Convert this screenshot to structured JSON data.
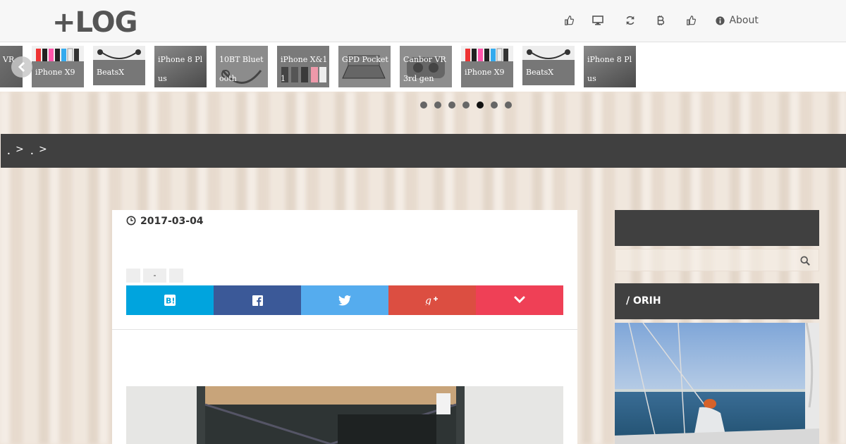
{
  "header": {
    "logo": "+LOG",
    "nav": [
      {
        "icon": "thumbs-up-icon"
      },
      {
        "icon": "desktop-icon"
      },
      {
        "icon": "refresh-icon"
      },
      {
        "icon": "bitcoin-icon"
      },
      {
        "icon": "thumbs-up-icon"
      },
      {
        "icon": "info-icon",
        "label": "About"
      }
    ]
  },
  "slider": {
    "items": [
      {
        "label": "VR"
      },
      {
        "label": "iPhone X9"
      },
      {
        "label": "BeatsX"
      },
      {
        "label": "iPhone 8 Plus"
      },
      {
        "label": "10BT Bluetooth"
      },
      {
        "label": "iPhone X&11"
      },
      {
        "label": "GPD Pocket"
      },
      {
        "label": "Canbor VR 3rd gen"
      },
      {
        "label": "iPhone X9"
      },
      {
        "label": "BeatsX"
      },
      {
        "label": "iPhone 8 Plus"
      }
    ],
    "dots": 7,
    "active_dot": 4
  },
  "breadcrumb": {
    "items": [
      {
        "text": "．",
        "sep": ">"
      },
      {
        "text": "．",
        "sep": ">"
      }
    ]
  },
  "article": {
    "date": "2017-03-04",
    "tags": [
      "",
      "-",
      ""
    ],
    "share": [
      {
        "icon": "hatena-bookmark-icon",
        "label": "B!",
        "color": "#00a4de"
      },
      {
        "icon": "facebook-icon",
        "label": "f",
        "color": "#3b5998"
      },
      {
        "icon": "twitter-icon",
        "label": "",
        "color": "#55acee"
      },
      {
        "icon": "google-plus-icon",
        "label": "g+",
        "color": "#dc4e41"
      },
      {
        "icon": "pocket-icon",
        "label": "",
        "color": "#ef4056"
      }
    ]
  },
  "sidebar": {
    "search_placeholder": "",
    "profile_title": "/ ORIH"
  },
  "colors": {
    "header_bg": "#f7f7f7",
    "dark_bar": "#404040",
    "page_bg": "#eee3d8"
  }
}
